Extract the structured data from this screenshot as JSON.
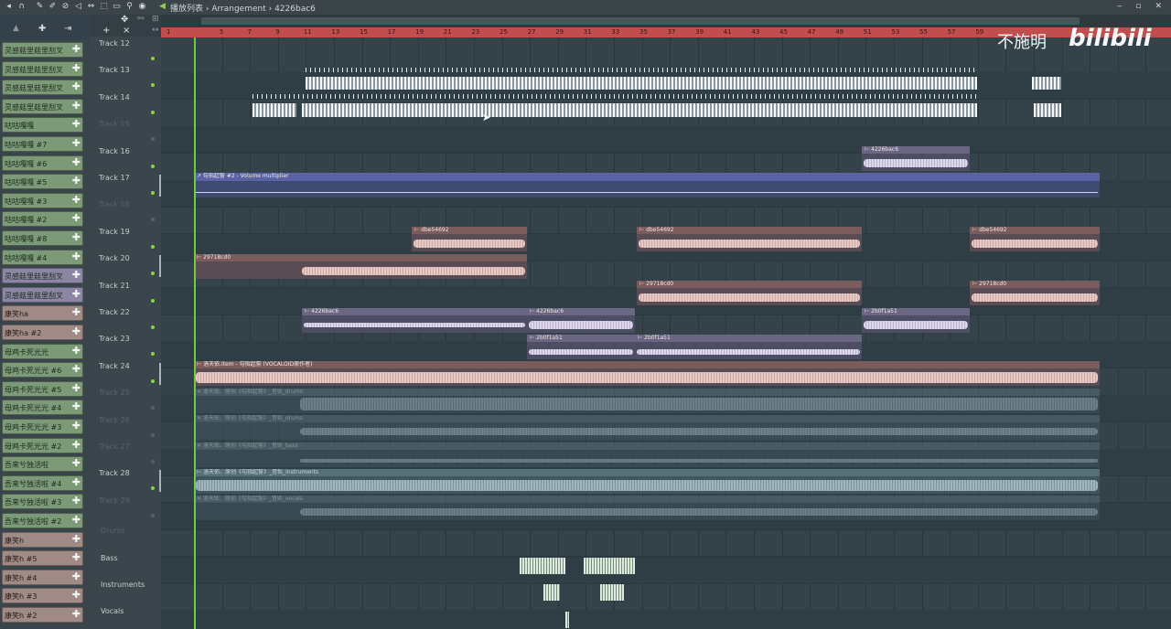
{
  "window": {
    "title_parts": [
      "播放列表",
      "Arrangement",
      "4226bac6"
    ],
    "title_sep": " › ",
    "controls": "‒ ▫ ✕"
  },
  "toolbar": {
    "tools": [
      "magnet-icon",
      "pencil-icon",
      "brush-icon",
      "delete-icon",
      "mute-icon",
      "slip-icon",
      "select-icon",
      "zoom-icon",
      "playback-icon",
      "speaker-icon"
    ]
  },
  "ruler": {
    "numbers": [
      "1",
      "5",
      "7",
      "9",
      "11",
      "13",
      "15",
      "17",
      "19",
      "21",
      "23",
      "25",
      "27",
      "29",
      "31",
      "33",
      "35",
      "37",
      "39",
      "41",
      "43",
      "45",
      "47",
      "49",
      "51",
      "53",
      "55",
      "57",
      "59"
    ]
  },
  "browser": {
    "channels": [
      {
        "name": "灵感菇里菇里刮叉",
        "style": "green"
      },
      {
        "name": "灵感菇里菇里刮叉",
        "style": "green"
      },
      {
        "name": "灵感菇里菇里刮叉",
        "style": "green"
      },
      {
        "name": "灵感菇里菇里刮叉",
        "style": "green"
      },
      {
        "name": "咕咕嘎嘎",
        "style": "green"
      },
      {
        "name": "咕咕嘎嘎 #7",
        "style": "green"
      },
      {
        "name": "咕咕嘎嘎 #6",
        "style": "green"
      },
      {
        "name": "咕咕嘎嘎 #5",
        "style": "green"
      },
      {
        "name": "咕咕嘎嘎 #3",
        "style": "green"
      },
      {
        "name": "咕咕嘎嘎 #2",
        "style": "green"
      },
      {
        "name": "咕咕嘎嘎 #8",
        "style": "green"
      },
      {
        "name": "咕咕嘎嘎 #4",
        "style": "green"
      },
      {
        "name": "灵感菇里菇里刮叉",
        "style": "purple"
      },
      {
        "name": "灵感菇里菇里刮叉",
        "style": "purple"
      },
      {
        "name": "康笑ha",
        "style": "pink"
      },
      {
        "name": "康笑ha #2",
        "style": "pink"
      },
      {
        "name": "母鸡卡死光光",
        "style": "green"
      },
      {
        "name": "母鸡卡死光光 #6",
        "style": "green"
      },
      {
        "name": "母鸡卡死光光 #5",
        "style": "green"
      },
      {
        "name": "母鸡卡死光光 #4",
        "style": "green"
      },
      {
        "name": "母鸡卡死光光 #3",
        "style": "green"
      },
      {
        "name": "母鸡卡死光光 #2",
        "style": "green"
      },
      {
        "name": "吾来兮独活啦",
        "style": "green"
      },
      {
        "name": "吾来兮独活啦 #4",
        "style": "green"
      },
      {
        "name": "吾来兮独活啦 #3",
        "style": "green"
      },
      {
        "name": "吾来兮独活啦 #2",
        "style": "green"
      },
      {
        "name": "康笑h",
        "style": "pink"
      },
      {
        "name": "康笑h #5",
        "style": "pink"
      },
      {
        "name": "康笑h #4",
        "style": "pink"
      },
      {
        "name": "康笑h #3",
        "style": "pink"
      },
      {
        "name": "康笑h #2",
        "style": "pink"
      }
    ]
  },
  "tracks": [
    {
      "label": "Track 12",
      "dim": false
    },
    {
      "label": "Track 13",
      "dim": false
    },
    {
      "label": "Track 14",
      "dim": false
    },
    {
      "label": "Track 15",
      "dim": true
    },
    {
      "label": "Track 16",
      "dim": false
    },
    {
      "label": "Track 17",
      "dim": false
    },
    {
      "label": "Track 18",
      "dim": true
    },
    {
      "label": "Track 19",
      "dim": false
    },
    {
      "label": "Track 20",
      "dim": false
    },
    {
      "label": "Track 21",
      "dim": false
    },
    {
      "label": "Track 22",
      "dim": false
    },
    {
      "label": "Track 23",
      "dim": false
    },
    {
      "label": "Track 24",
      "dim": false
    },
    {
      "label": "Track 25",
      "dim": true
    },
    {
      "label": "Track 26",
      "dim": true
    },
    {
      "label": "Track 27",
      "dim": true
    },
    {
      "label": "Track 28",
      "dim": false
    },
    {
      "label": "Track 29",
      "dim": true
    }
  ],
  "clips": {
    "c16a": "⊢ 4226bac6",
    "c17": "↗ 勾指起誓 #2 - Volume multiplier",
    "c19a": "⊢ dbe54692",
    "c19b": "⊢ dbe54692",
    "c19c": "⊢ dbe54692",
    "c20a": "⊢ 29718cd0",
    "c21a": "⊢ 29718cd0",
    "c21b": "⊢ 29718cd0",
    "c22a": "⊢ 4226bac6",
    "c22b": "⊢ 4226bac6",
    "c22c": "⊢ 2b0f1a51",
    "c23a": "⊢ 2b0f1a51",
    "c23b": "⊢ 2b0f1a51",
    "c24": "⊢ 洛天依.item - 勾指起誓 (VOCALOID原作者)",
    "c25": "✕ 洛天依、原创《勾指起誓》_音轨_drums",
    "c26": "✕ 洛天依、原创《勾指起誓》_音轨_drums",
    "c27": "✕ 洛天依、原创《勾指起誓》_音轨_bass",
    "c28": "⊢ 洛天依、原创《勾指起誓》_音轨_instruments",
    "c29": "✕ 洛天依、原创《勾指起誓》_音轨_vocals"
  },
  "pattern_tracks": [
    {
      "label": "Drums",
      "dim": true
    },
    {
      "label": "Bass",
      "dim": false
    },
    {
      "label": "Instruments",
      "dim": false
    },
    {
      "label": "Vocals",
      "dim": false
    }
  ],
  "watermark": {
    "text": "不施明",
    "logo": "bilibili"
  }
}
